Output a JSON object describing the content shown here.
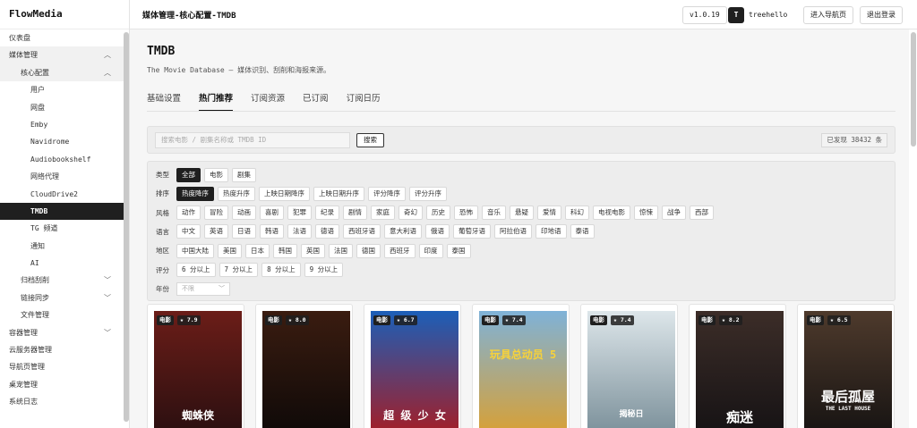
{
  "app": {
    "brand": "FlowMedia"
  },
  "sidebar": {
    "items": [
      {
        "label": "仪表盘",
        "level": 1
      },
      {
        "label": "媒体管理",
        "level": 1,
        "expanded": true
      },
      {
        "label": "核心配置",
        "level": 2,
        "expanded": true
      },
      {
        "label": "用户",
        "level": 3
      },
      {
        "label": "网盘",
        "level": 3
      },
      {
        "label": "Emby",
        "level": 3
      },
      {
        "label": "Navidrome",
        "level": 3
      },
      {
        "label": "Audiobookshelf",
        "level": 3
      },
      {
        "label": "网络代理",
        "level": 3
      },
      {
        "label": "CloudDrive2",
        "level": 3
      },
      {
        "label": "TMDB",
        "level": 3,
        "active": true
      },
      {
        "label": "TG 频道",
        "level": 3
      },
      {
        "label": "通知",
        "level": 3
      },
      {
        "label": "AI",
        "level": 3
      },
      {
        "label": "归档刮削",
        "level": 2,
        "collapsed": true
      },
      {
        "label": "链接同步",
        "level": 2,
        "collapsed": true
      },
      {
        "label": "文件管理",
        "level": 2
      },
      {
        "label": "容器管理",
        "level": 1,
        "collapsed": true
      },
      {
        "label": "云服务器管理",
        "level": 1
      },
      {
        "label": "导航页管理",
        "level": 1
      },
      {
        "label": "桌宠管理",
        "level": 1
      },
      {
        "label": "系统日志",
        "level": 1
      }
    ]
  },
  "topbar": {
    "title": "媒体管理-核心配置-TMDB",
    "version": "v1.0.19",
    "avatar": "T",
    "username": "treehello",
    "nav_label": "进入导航页",
    "logout_label": "退出登录"
  },
  "page": {
    "title": "TMDB",
    "subtitle": "The Movie Database — 媒体识别、刮削和海报来源。"
  },
  "tabs": [
    "基础设置",
    "热门推荐",
    "订阅资源",
    "已订阅",
    "订阅日历"
  ],
  "active_tab": "热门推荐",
  "search": {
    "placeholder": "搜索电影 / 剧集名称或 TMDB ID",
    "button": "搜索",
    "found": "已发现 38432 条"
  },
  "filters": {
    "type": {
      "label": "类型",
      "options": [
        "全部",
        "电影",
        "剧集"
      ],
      "selected": "全部"
    },
    "sort": {
      "label": "排序",
      "options": [
        "热度降序",
        "热度升序",
        "上映日期降序",
        "上映日期升序",
        "评分降序",
        "评分升序"
      ],
      "selected": "热度降序"
    },
    "genre": {
      "label": "风格",
      "options": [
        "动作",
        "冒险",
        "动画",
        "喜剧",
        "犯罪",
        "纪录",
        "剧情",
        "家庭",
        "奇幻",
        "历史",
        "恐怖",
        "音乐",
        "悬疑",
        "爱情",
        "科幻",
        "电视电影",
        "惊悚",
        "战争",
        "西部"
      ]
    },
    "language": {
      "label": "语言",
      "options": [
        "中文",
        "英语",
        "日语",
        "韩语",
        "法语",
        "德语",
        "西班牙语",
        "意大利语",
        "俄语",
        "葡萄牙语",
        "阿拉伯语",
        "印地语",
        "泰语"
      ]
    },
    "region": {
      "label": "地区",
      "options": [
        "中国大陆",
        "美国",
        "日本",
        "韩国",
        "英国",
        "法国",
        "德国",
        "西班牙",
        "印度",
        "泰国"
      ]
    },
    "rating": {
      "label": "评分",
      "options": [
        "6 分以上",
        "7 分以上",
        "8 分以上",
        "9 分以上"
      ]
    },
    "year": {
      "label": "年份",
      "placeholder": "不限"
    }
  },
  "cards": [
    {
      "type": "电影",
      "rating": "★ 7.9",
      "poster_text": "蜘蛛侠",
      "colors": [
        "#6b1d18",
        "#2a0f10"
      ]
    },
    {
      "type": "电影",
      "rating": "★ 8.0",
      "poster_text": "",
      "colors": [
        "#3a1c10",
        "#0e0908"
      ]
    },
    {
      "type": "电影",
      "rating": "★ 6.7",
      "poster_text": "超 级 少 女",
      "colors": [
        "#1c5fb8",
        "#a51d25"
      ]
    },
    {
      "type": "电影",
      "rating": "★ 7.4",
      "poster_text": "玩具总动员 5",
      "colors": [
        "#7fb2d8",
        "#d9a033"
      ]
    },
    {
      "type": "电影",
      "rating": "★ 7.4",
      "poster_text": "揭秘日",
      "colors": [
        "#dde6ea",
        "#7a8f99"
      ]
    },
    {
      "type": "电影",
      "rating": "★ 8.2",
      "poster_text": "痴迷",
      "colors": [
        "#3c2d28",
        "#151214"
      ]
    },
    {
      "type": "电影",
      "rating": "★ 6.5",
      "poster_text": "最后孤屋",
      "poster_sub": "THE LAST HOUSE",
      "colors": [
        "#4e3a2c",
        "#161312"
      ]
    }
  ]
}
